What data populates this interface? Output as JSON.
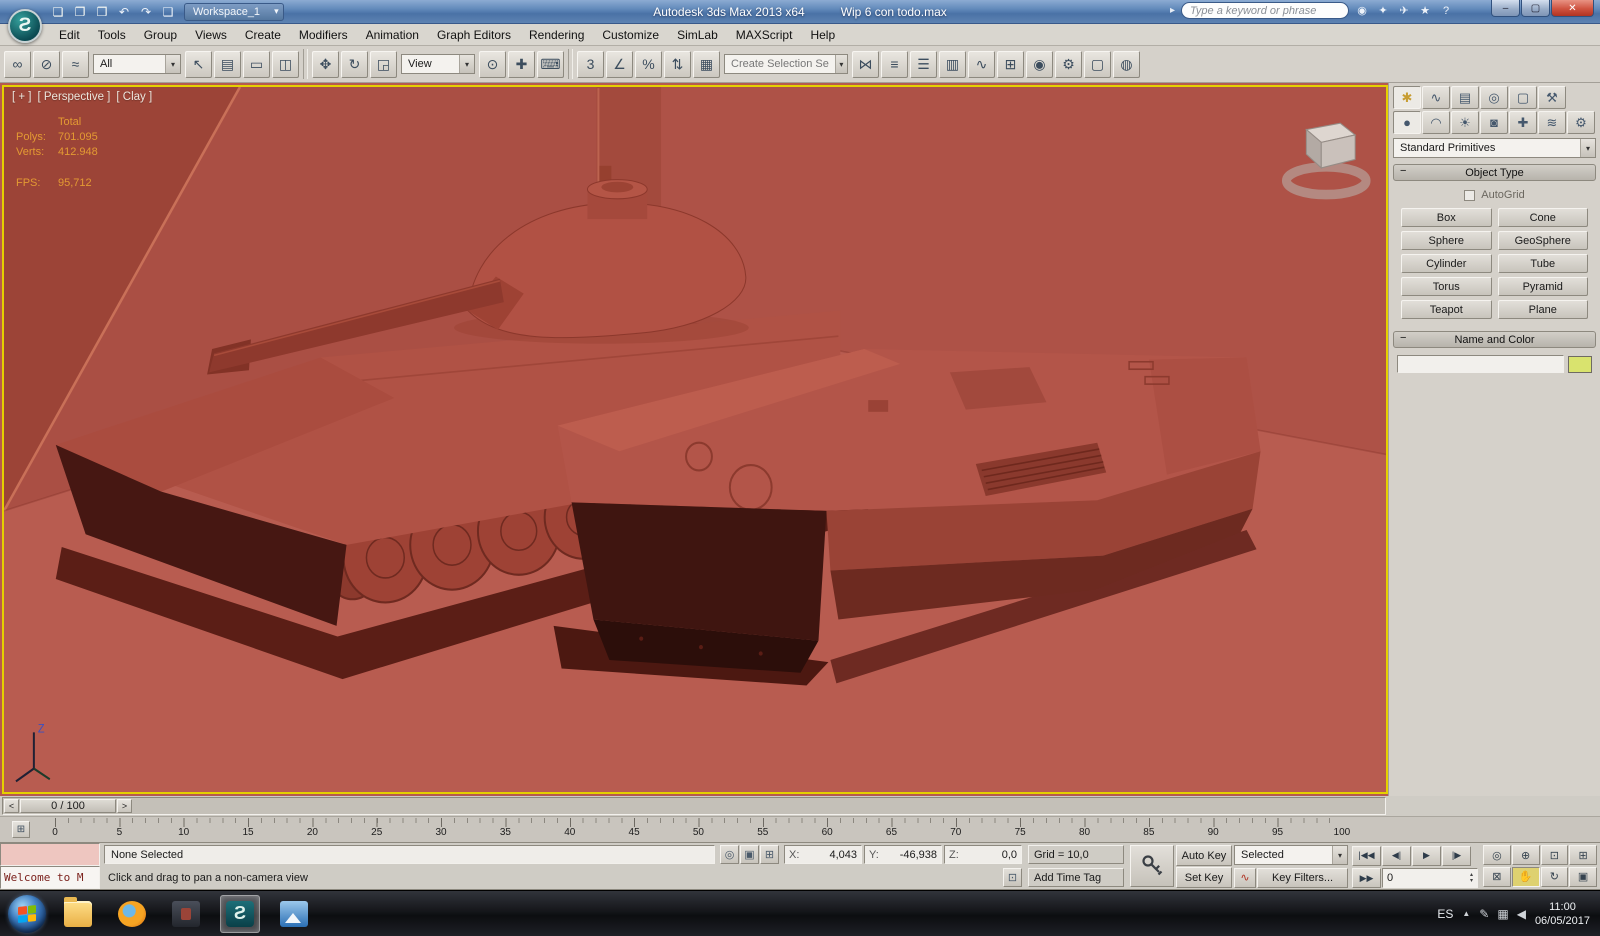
{
  "titlebar": {
    "workspace": "Workspace_1",
    "app_title": "Autodesk 3ds Max 2013 x64",
    "file_title": "Wip 6 con todo.max",
    "search_placeholder": "Type a keyword or phrase",
    "quick_access": [
      {
        "name": "new-file-icon",
        "glyph": "❏"
      },
      {
        "name": "open-file-icon",
        "glyph": "❐"
      },
      {
        "name": "save-file-icon",
        "glyph": "❒"
      },
      {
        "name": "undo-icon",
        "glyph": "↶"
      },
      {
        "name": "redo-icon",
        "glyph": "↷"
      },
      {
        "name": "project-folder-icon",
        "glyph": "❑"
      }
    ],
    "info_icons": [
      {
        "name": "search-go-icon",
        "glyph": "◉"
      },
      {
        "name": "subscription-key-icon",
        "glyph": "✦"
      },
      {
        "name": "communication-center-icon",
        "glyph": "✈"
      },
      {
        "name": "favorites-star-icon",
        "glyph": "★"
      },
      {
        "name": "help-icon",
        "glyph": "?"
      }
    ],
    "window_buttons": [
      {
        "name": "minimize-button",
        "glyph": "–"
      },
      {
        "name": "maximize-button",
        "glyph": "▢"
      },
      {
        "name": "close-button",
        "glyph": "✕",
        "cls": "close"
      }
    ]
  },
  "menubar": {
    "items": [
      {
        "name": "menu-edit",
        "label": "Edit"
      },
      {
        "name": "menu-tools",
        "label": "Tools"
      },
      {
        "name": "menu-group",
        "label": "Group"
      },
      {
        "name": "menu-views",
        "label": "Views"
      },
      {
        "name": "menu-create",
        "label": "Create"
      },
      {
        "name": "menu-modifiers",
        "label": "Modifiers"
      },
      {
        "name": "menu-animation",
        "label": "Animation"
      },
      {
        "name": "menu-graph-editors",
        "label": "Graph Editors"
      },
      {
        "name": "menu-rendering",
        "label": "Rendering"
      },
      {
        "name": "menu-customize",
        "label": "Customize"
      },
      {
        "name": "menu-simlab",
        "label": "SimLab"
      },
      {
        "name": "menu-maxscript",
        "label": "MAXScript"
      },
      {
        "name": "menu-help",
        "label": "Help"
      }
    ]
  },
  "toolbar": {
    "filter_value": "All",
    "coord_value": "View",
    "selection_set_value": "Create Selection Se",
    "group1": [
      {
        "name": "select-and-link-icon",
        "glyph": "∞"
      },
      {
        "name": "unlink-selection-icon",
        "glyph": "⊘"
      },
      {
        "name": "bind-to-space-warp-icon",
        "glyph": "≈"
      }
    ],
    "group2": [
      {
        "name": "select-object-icon",
        "glyph": "↖"
      },
      {
        "name": "select-by-name-icon",
        "glyph": "▤"
      },
      {
        "name": "rectangular-selection-icon",
        "glyph": "▭"
      },
      {
        "name": "window-crossing-icon",
        "glyph": "◫"
      }
    ],
    "group3": [
      {
        "name": "select-and-move-icon",
        "glyph": "✥"
      },
      {
        "name": "select-and-rotate-icon",
        "glyph": "↻"
      },
      {
        "name": "select-and-scale-icon",
        "glyph": "◲"
      }
    ],
    "group4": [
      {
        "name": "use-pivot-center-icon",
        "glyph": "⊙"
      },
      {
        "name": "select-and-manipulate-icon",
        "glyph": "✚"
      },
      {
        "name": "keyboard-override-icon",
        "glyph": "⌨"
      }
    ],
    "group5": [
      {
        "name": "snap-toggle-3d-icon",
        "glyph": "3"
      },
      {
        "name": "angle-snap-icon",
        "glyph": "∠"
      },
      {
        "name": "percent-snap-icon",
        "glyph": "%"
      },
      {
        "name": "spinner-snap-icon",
        "glyph": "⇅"
      },
      {
        "name": "named-selection-sets-icon",
        "glyph": "▦"
      }
    ],
    "group6": [
      {
        "name": "mirror-icon",
        "glyph": "⋈"
      },
      {
        "name": "align-icon",
        "glyph": "≡"
      },
      {
        "name": "layer-manager-icon",
        "glyph": "☰"
      },
      {
        "name": "graphite-ribbon-icon",
        "glyph": "▥"
      },
      {
        "name": "curve-editor-icon",
        "glyph": "∿"
      },
      {
        "name": "schematic-view-icon",
        "glyph": "⊞"
      },
      {
        "name": "material-editor-icon",
        "glyph": "◉"
      },
      {
        "name": "render-setup-icon",
        "glyph": "⚙"
      },
      {
        "name": "rendered-frame-icon",
        "glyph": "▢"
      },
      {
        "name": "render-production-icon",
        "glyph": "◍"
      }
    ]
  },
  "viewport": {
    "label_plus": "[ + ]",
    "label_pov": "[ Perspective ]",
    "label_shading": "[ Clay ]",
    "stats": {
      "total": "Total",
      "polys_label": "Polys:",
      "polys": "701.095",
      "verts_label": "Verts:",
      "verts": "412.948",
      "fps_label": "FPS:",
      "fps": "95,712"
    },
    "axis_z": "Z"
  },
  "command_panel": {
    "tabs": [
      {
        "name": "create-tab",
        "glyph": "✱",
        "active": true
      },
      {
        "name": "modify-tab",
        "glyph": "∿"
      },
      {
        "name": "hierarchy-tab",
        "glyph": "▤"
      },
      {
        "name": "motion-tab",
        "glyph": "◎"
      },
      {
        "name": "display-tab",
        "glyph": "▢"
      },
      {
        "name": "utilities-tab",
        "glyph": "⚒"
      }
    ],
    "categories": [
      {
        "name": "geometry-category",
        "glyph": "●",
        "active": true
      },
      {
        "name": "shapes-category",
        "glyph": "◠"
      },
      {
        "name": "lights-category",
        "glyph": "☀"
      },
      {
        "name": "cameras-category",
        "glyph": "◙"
      },
      {
        "name": "helpers-category",
        "glyph": "✚"
      },
      {
        "name": "space-warps-category",
        "glyph": "≋"
      },
      {
        "name": "systems-category",
        "glyph": "⚙"
      }
    ],
    "subcategory": "Standard Primitives",
    "object_type": {
      "title": "Object Type",
      "autogrid": "AutoGrid",
      "buttons": [
        {
          "name": "box-button",
          "label": "Box"
        },
        {
          "name": "cone-button",
          "label": "Cone"
        },
        {
          "name": "sphere-button",
          "label": "Sphere"
        },
        {
          "name": "geosphere-button",
          "label": "GeoSphere"
        },
        {
          "name": "cylinder-button",
          "label": "Cylinder"
        },
        {
          "name": "tube-button",
          "label": "Tube"
        },
        {
          "name": "torus-button",
          "label": "Torus"
        },
        {
          "name": "pyramid-button",
          "label": "Pyramid"
        },
        {
          "name": "teapot-button",
          "label": "Teapot"
        },
        {
          "name": "plane-button",
          "label": "Plane"
        }
      ]
    },
    "name_color": {
      "title": "Name and Color",
      "swatch_color": "#d9e36e"
    }
  },
  "timeline": {
    "frame_display": "0 / 100",
    "prev": "<",
    "next": ">",
    "ticks": [
      "0",
      "5",
      "10",
      "15",
      "20",
      "25",
      "30",
      "35",
      "40",
      "45",
      "50",
      "55",
      "60",
      "65",
      "70",
      "75",
      "80",
      "85",
      "90",
      "95",
      "100"
    ]
  },
  "statusbar": {
    "listener_text": "Welcome to M",
    "selection_status": "None Selected",
    "prompt": "Click and drag to pan a non-camera view",
    "prompt_icon": "⊡",
    "status_icons": [
      {
        "name": "isolate-selection-icon",
        "glyph": "◎"
      },
      {
        "name": "selection-lock-icon",
        "glyph": "▣"
      },
      {
        "name": "absolute-offset-icon",
        "glyph": "⊞"
      }
    ],
    "coords": {
      "x_label": "X:",
      "x": "4,043",
      "y_label": "Y:",
      "y": "-46,938",
      "z_label": "Z:",
      "z": "0,0"
    },
    "grid_display": "Grid = 10,0",
    "add_time_tag": "Add Time Tag",
    "auto_key": "Auto Key",
    "set_key": "Set Key",
    "key_mode": "Selected",
    "key_filters": "Key Filters...",
    "tangent_glyph": "∿",
    "frame": "0",
    "go_end_glyph": "▶▶",
    "transport": [
      {
        "name": "go-to-start-button",
        "glyph": "|◀◀"
      },
      {
        "name": "previous-frame-button",
        "glyph": "◀|"
      },
      {
        "name": "play-button",
        "glyph": "▶"
      },
      {
        "name": "next-frame-button",
        "glyph": "|▶"
      }
    ],
    "nav_buttons": [
      {
        "name": "zoom-icon",
        "glyph": "◎"
      },
      {
        "name": "zoom-all-icon",
        "glyph": "⊕"
      },
      {
        "name": "zoom-extents-icon",
        "glyph": "⊡"
      },
      {
        "name": "zoom-extents-all-icon",
        "glyph": "⊞"
      },
      {
        "name": "zoom-region-icon",
        "glyph": "⊠"
      },
      {
        "name": "pan-hand-icon",
        "glyph": "✋",
        "active": true
      },
      {
        "name": "orbit-icon",
        "glyph": "↻"
      },
      {
        "name": "maximize-viewport-icon",
        "glyph": "▣"
      }
    ]
  },
  "taskbar": {
    "lang": "ES",
    "tray_arrow": "▲",
    "time": "11:00",
    "date": "06/05/2017",
    "icons": [
      {
        "name": "explorer-taskbar-icon",
        "cls": "ic-explorer"
      },
      {
        "name": "firefox-taskbar-icon",
        "cls": "ic-firefox"
      },
      {
        "name": "secondary-app-taskbar-icon",
        "cls": "ic-dark"
      },
      {
        "name": "3dsmax-taskbar-icon",
        "cls": "ic-max",
        "active": true
      },
      {
        "name": "image-viewer-taskbar-icon",
        "cls": "ic-viewer"
      }
    ],
    "tray_icons": [
      {
        "name": "pen-tray-icon",
        "glyph": "✎"
      },
      {
        "name": "network-tray-icon",
        "glyph": "▦"
      },
      {
        "name": "volume-tray-icon",
        "glyph": "◀"
      }
    ]
  }
}
